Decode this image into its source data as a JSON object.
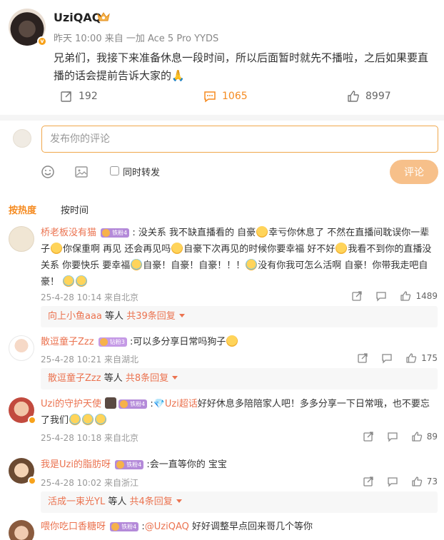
{
  "post": {
    "author": "UziQAQ",
    "meta": "昨天 10:00 来自 一加 Ace 5 Pro YYDS",
    "body": "兄弟们，我接下来准备休息一段时间，所以后面暂时就先不播啦，之后如果要直播的话会提前告诉大家的🙏",
    "reposts": "192",
    "comments": "1065",
    "likes": "8997"
  },
  "composer": {
    "placeholder": "发布你的评论",
    "repost_label": "同时转发",
    "submit_label": "评论"
  },
  "sort": {
    "hot": "按热度",
    "time": "按时间"
  },
  "comments": [
    {
      "name": "桥老板没有猫",
      "badge": "铁粉4",
      "text_parts": [
        ": 没关系 我不缺直播看的 自豪",
        "幸亏你休息了 不然在直播间耽误你一辈子",
        "你保重啊 再见 还会再见吗",
        "自豪下次再见的时候你要幸福 好不好",
        "我看不到你的直播没关系 你要快乐 要幸福",
        "自豪！自豪！自豪！！！",
        "没有你我可怎么活啊 自豪！你带我走吧自豪！"
      ],
      "meta": "25-4-28 10:14 来自北京",
      "likes": "1489",
      "reply_who": "向上小鱼aaa",
      "reply_etc": "等人",
      "reply_count": "共39条回复"
    },
    {
      "name": "散逗童子Zzz",
      "badge": "钻粉3",
      "text": ":可以多分享日常吗狗子",
      "meta": "25-4-28 10:21 来自湖北",
      "likes": "175",
      "reply_who": "散逗童子Zzz",
      "reply_etc": "等人",
      "reply_count": "共8条回复"
    },
    {
      "name": "Uzi的守护天使",
      "badge": "铁粉4",
      "mention": "Uzi超话",
      "text": "好好休息多陪陪家人吧！多多分享一下日常哦，也不要忘了我们",
      "meta": "25-4-28 10:18 来自北京",
      "likes": "89"
    },
    {
      "name": "我是Uzi的脂肪呀",
      "badge": "铁粉4",
      "text": ":会一直等你的 宝宝",
      "meta": "25-4-28 10:02 来自浙江",
      "likes": "73",
      "reply_who": "活成一束光YL",
      "reply_etc": "等人",
      "reply_count": "共4条回复"
    },
    {
      "name": "喂你吃口香糖呀",
      "badge": "铁粉4",
      "mention": "@UziQAQ",
      "text": " 好好调整早点回来哥几个等你"
    }
  ],
  "colors": {
    "accent": "#f58a1f",
    "name": "#eb7350",
    "submit": "#f7c08a"
  }
}
